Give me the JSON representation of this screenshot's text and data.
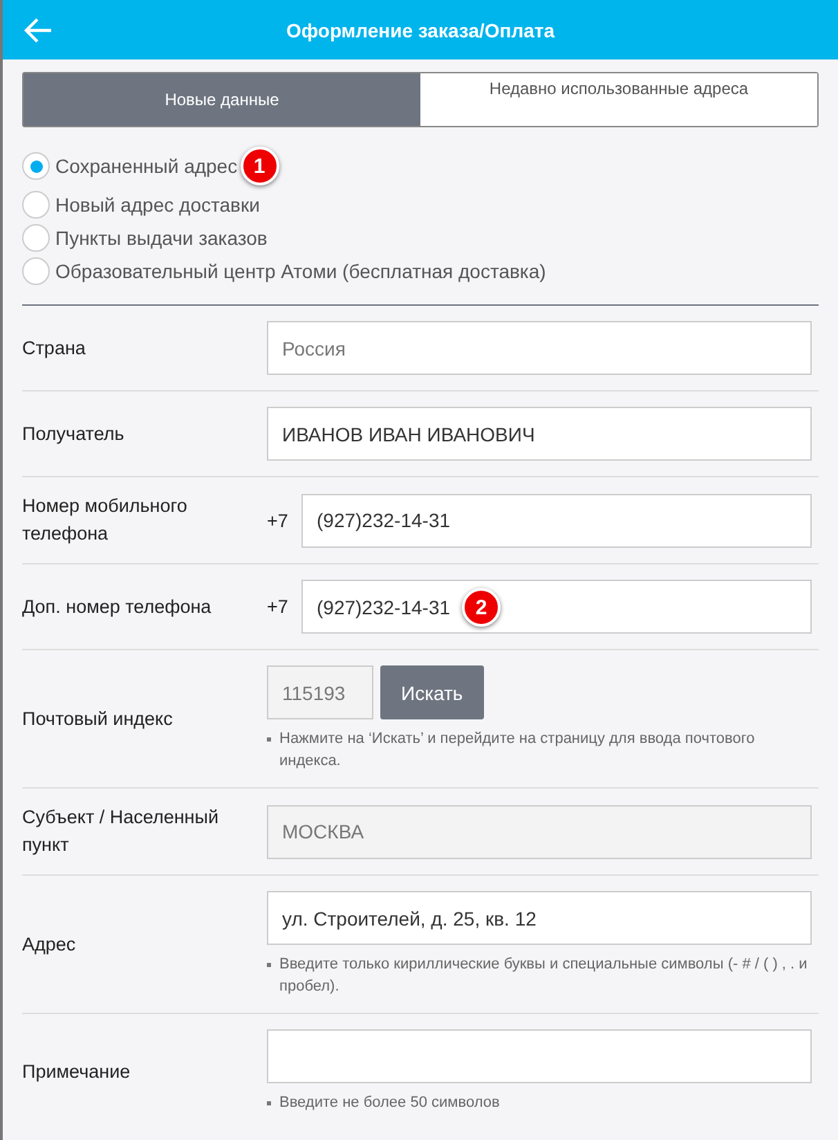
{
  "header": {
    "title": "Оформление заказа/Оплата"
  },
  "tabs": [
    {
      "label": "Новые данные",
      "selected": true
    },
    {
      "label": "Недавно использованные адреса",
      "selected": false
    }
  ],
  "address_options": [
    {
      "label": "Сохраненный адрес",
      "selected": true,
      "badge": "1"
    },
    {
      "label": "Новый адрес доставки",
      "selected": false
    },
    {
      "label": "Пункты выдачи заказов",
      "selected": false
    },
    {
      "label": "Образовательный центр Атоми (бесплатная доставка)",
      "selected": false
    }
  ],
  "rows": [
    {
      "kind": "text",
      "label": "Страна",
      "field": {
        "placeholder": "Россия",
        "disabled": false
      }
    },
    {
      "kind": "text",
      "label": "Получатель",
      "field": {
        "value": "ИВАНОВ ИВАН ИВАНОВИЧ",
        "disabled": false
      }
    },
    {
      "kind": "phone",
      "label": "Номер мобильного телефона",
      "prefix": "+7",
      "field": {
        "value": "(927)232-14-31",
        "disabled": false
      }
    },
    {
      "kind": "phone",
      "label": "Доп. номер телефона",
      "prefix": "+7",
      "field": {
        "value": "(927)232-14-31",
        "disabled": false,
        "badge": "2"
      }
    },
    {
      "kind": "postal",
      "label": "Почтовый индекс",
      "field": {
        "value": "115193",
        "disabled": true
      },
      "button": "Искать",
      "hint": "Нажмите на ‘Искать’ и перейдите на страницу для ввода почтового индекса."
    },
    {
      "kind": "text",
      "label": "Субъект / Населенный пункт",
      "field": {
        "value": "МОСКВА",
        "disabled": true
      }
    },
    {
      "kind": "text",
      "label": "Адрес",
      "field": {
        "value": "ул. Строителей, д. 25, кв. 12",
        "disabled": false
      },
      "hint": "Введите только кириллические буквы и специальные символы (- # / ( ) , . и пробел)."
    },
    {
      "kind": "text",
      "label": "Примечание",
      "field": {
        "disabled": false
      },
      "hint": "Введите не более 50 символов"
    }
  ]
}
